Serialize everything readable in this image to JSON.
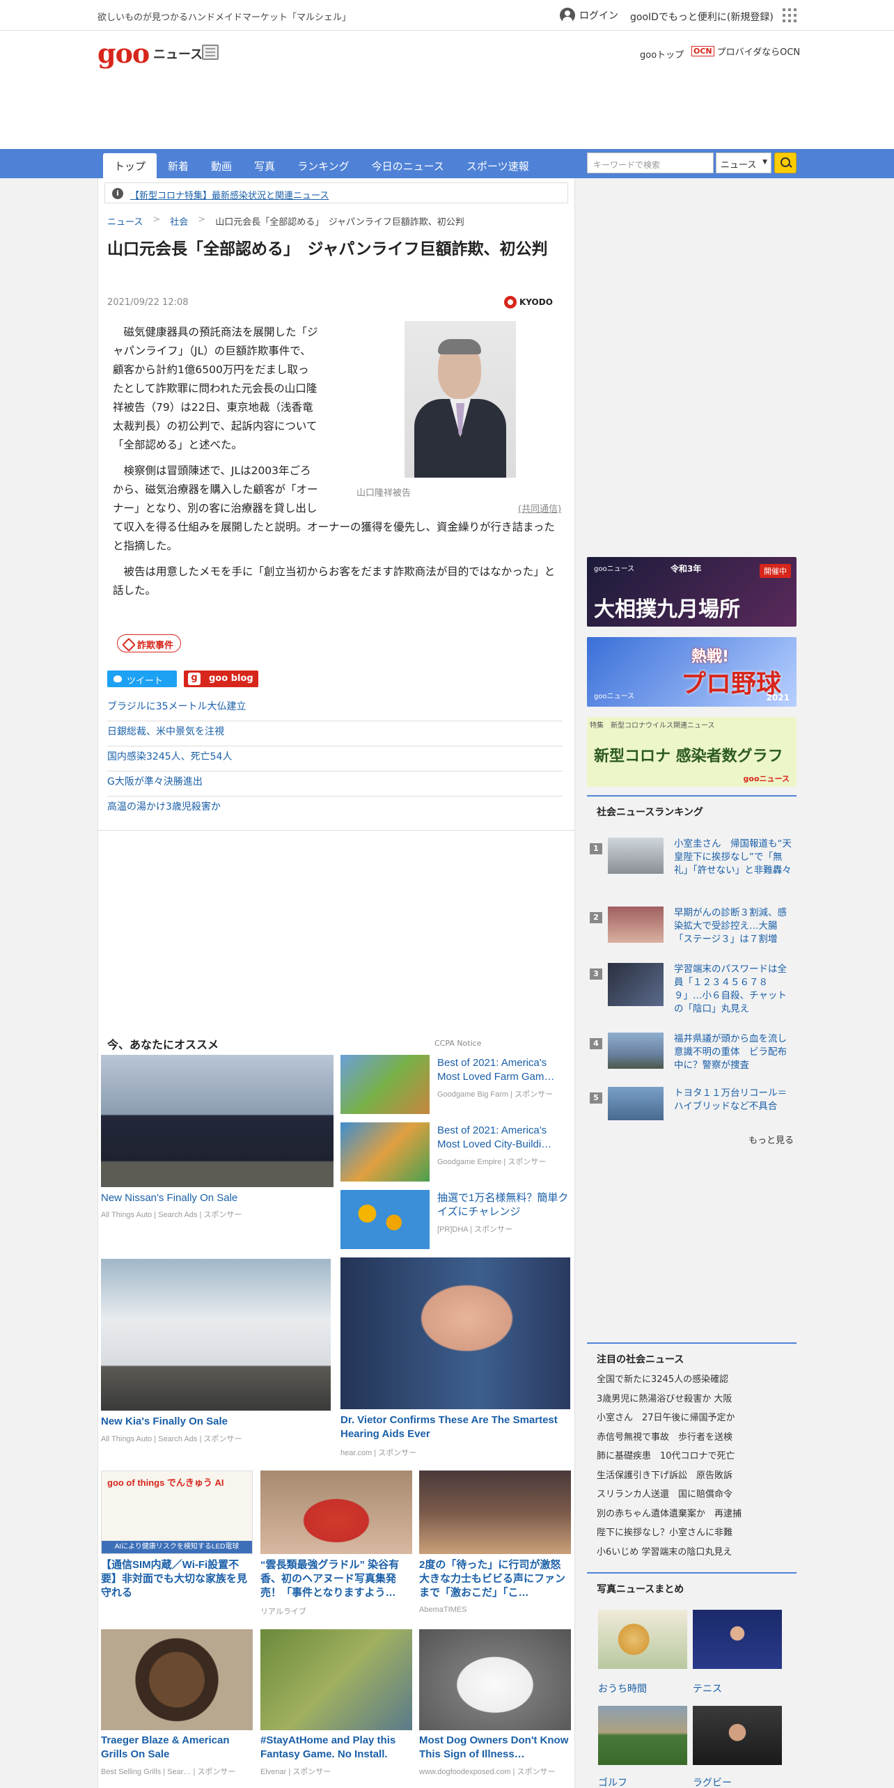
{
  "topbar": {
    "promo": "欲しいものが見つかるハンドメイドマーケット「マルシェル」",
    "login": "ログイン",
    "gooid": "gooIDでもっと便利に(新規登録)"
  },
  "header": {
    "logo": "goo",
    "news": "ニュース",
    "goo_top": "gooトップ",
    "ocn_badge": "OCN",
    "ocn_text": "プロバイダならOCN"
  },
  "nav": {
    "tabs": [
      "トップ",
      "新着",
      "動画",
      "写真",
      "ランキング",
      "今日のニュース",
      "スポーツ速報"
    ],
    "search_placeholder": "キーワードで検索",
    "search_scope": "ニュース"
  },
  "notice": {
    "text": "【新型コロナ特集】最新感染状況と関連ニュース"
  },
  "breadcrumb": {
    "items": [
      "ニュース",
      "社会",
      "山口元会長「全部認める」　ジャパンライフ巨額詐欺、初公判"
    ],
    "sep": ">"
  },
  "article": {
    "title": "山口元会長「全部認める」　ジャパンライフ巨額詐欺、初公判",
    "date": "2021/09/22 12:08",
    "provider": "KYODO",
    "paragraphs": [
      "磁気健康器具の預託商法を展開した「ジャパンライフ」（JL）の巨額詐欺事件で、顧客から計約1億6500万円をだまし取ったとして詐欺罪に問われた元会長の山口隆祥被告（79）は22日、東京地裁（浅香竜太裁判長）の初公判で、起訴内容について「全部認める」と述べた。",
      "検察側は冒頭陳述で、JLは2003年ごろから、磁気治療器を購入した顧客が「オーナー」となり、別の客に治療器を貸し出して収入を得る仕組みを展開したと説明。オーナーの獲得を優先し、資金繰りが行き詰まったと指摘した。",
      "被告は用意したメモを手に「創立当初からお客をだます詐欺商法が目的ではなかった」と話した。"
    ],
    "photo_caption": "山口隆祥被告",
    "source": "(共同通信)",
    "tag": "詐欺事件",
    "tweet": "ツイート",
    "goo_blog": "goo blog",
    "related": [
      "ブラジルに35メートル大仏建立",
      "日銀総裁、米中景気を注視",
      "国内感染3245人、死亡54人",
      "G大阪が準々決勝進出",
      "高温の湯かけ3歳児殺害か"
    ]
  },
  "recommend": {
    "title": "今、あなたにオススメ",
    "ccpa": "CCPA Notice",
    "cards": [
      {
        "title": "New Nissan's Finally On Sale",
        "src": "All Things Auto | Search Ads | スポンサー"
      },
      {
        "title": "Best of 2021: America's Most Loved Farm Gam…",
        "src": "Goodgame Big Farm | スポンサー"
      },
      {
        "title": "Best of 2021: America's Most Loved City-Buildi…",
        "src": "Goodgame Empire | スポンサー"
      },
      {
        "title": "抽選で1万名様無料？簡単クイズにチャレンジ",
        "src": "[PR]DHA | スポンサー"
      },
      {
        "title": "New Kia's Finally On Sale",
        "src": "All Things Auto | Search Ads | スポンサー"
      },
      {
        "title": "Dr. Vietor Confirms These Are The Smartest Hearing Aids Ever",
        "src": "hear.com | スポンサー"
      },
      {
        "title": "【通信SIM内蔵／Wi-Fi設置不要】非対面でも大切な家族を見守れる",
        "src": "",
        "img_text": "goo of things でんきゅう AI",
        "img_sub": "AIにより健康リスクを検知するLED電球"
      },
      {
        "title": "“雲長類最強グラドル” 染谷有香、初のヘアヌード写真集発売！「事件となりますよう…",
        "src": "リアルライブ"
      },
      {
        "title": "2度の「待った」に行司が激怒 大きな力士もビビる声にファンまで「激おこだ」「こ…",
        "src": "AbemaTIMES"
      },
      {
        "title": "Traeger Blaze & American Grills On Sale",
        "src": "Best Selling Grills | Sear… | スポンサー"
      },
      {
        "title": "#StayAtHome and Play this Fantasy Game. No Install.",
        "src": "Elvenar | スポンサー"
      },
      {
        "title": "Most Dog Owners Don't Know This Sign of Illness…",
        "src": "www.dogfoodexposed.com | スポンサー"
      }
    ]
  },
  "sidebar": {
    "banner1": {
      "brand": "gooニュース",
      "year": "令和3年",
      "title": "大相撲九月場所",
      "badge": "開催中"
    },
    "banner2": {
      "t1": "熱戦!",
      "t2": "プロ野球",
      "brand": "gooニュース",
      "year": "2021"
    },
    "banner3": {
      "top": "特集　新型コロナウイルス関連ニュース",
      "title": "新型コロナ 感染者数グラフ",
      "brand": "gooニュース"
    },
    "ranking_title": "社会ニュースランキング",
    "ranking": [
      {
        "num": "1",
        "text": "小室圭さん　帰国報道も“天皇陛下に挨拶なし”で「無礼」「許せない」と非難轟々"
      },
      {
        "num": "2",
        "text": "早期がんの診断３割減、感染拡大で受診控え…大腸「ステージ３」は７割増"
      },
      {
        "num": "3",
        "text": "学習端末のパスワードは全員「１２３４５６７８９」…小６自殺、チャットの「陰口」丸見え"
      },
      {
        "num": "4",
        "text": "福井県議が頭から血を流し意識不明の重体　ビラ配布中に？警察が捜査"
      },
      {
        "num": "5",
        "text": "トヨタ１１万台リコール＝ハイブリッドなど不具合"
      }
    ],
    "more": "もっと見る",
    "attention_title": "注目の社会ニュース",
    "attention": [
      "全国で新たに3245人の感染確認",
      "3歳男児に熱湯浴びせ殺害か 大阪",
      "小室さん　27日午後に帰国予定か",
      "赤信号無視で事故　歩行者を送検",
      "肺に基礎疾患　10代コロナで死亡",
      "生活保護引き下げ訴訟　原告敗訴",
      "スリランカ人送還　国に賠償命令",
      "別の赤ちゃん遺体遺棄案か　再逮捕",
      "陛下に挨拶なし？小室さんに非難",
      "小6いじめ 学習端末の陰口丸見え"
    ],
    "photo_title": "写真ニュースまとめ",
    "photos": [
      "おうち時間",
      "テニス",
      "ゴルフ",
      "ラグビー"
    ]
  },
  "colors": {
    "accent": "#4f82d6",
    "brand": "#d7261b",
    "link": "#1a5fa8"
  }
}
